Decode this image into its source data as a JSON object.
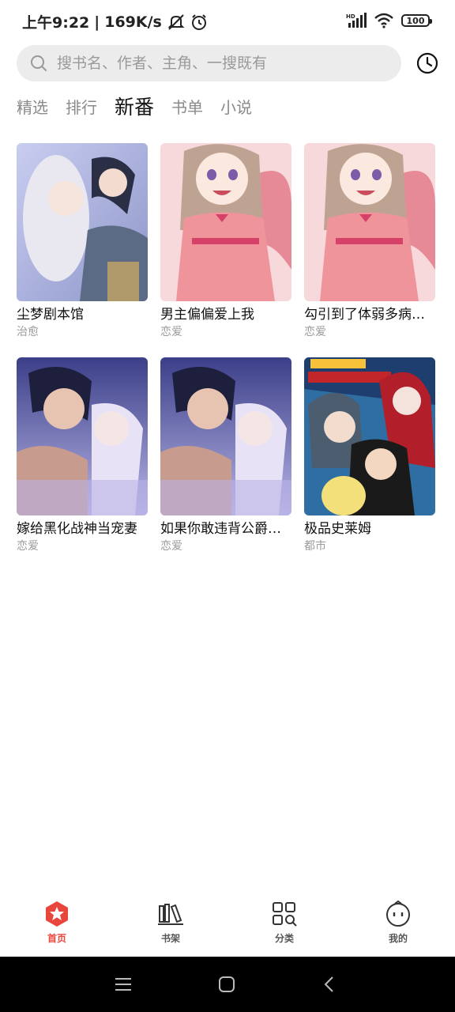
{
  "status_bar": {
    "time": "上午9:22",
    "net_speed": "169K/s",
    "battery": "100"
  },
  "search": {
    "placeholder": "搜书名、作者、主角、一搜既有"
  },
  "tabs": [
    {
      "label": "精选",
      "active": false
    },
    {
      "label": "排行",
      "active": false
    },
    {
      "label": "新番",
      "active": true
    },
    {
      "label": "书单",
      "active": false
    },
    {
      "label": "小说",
      "active": false
    }
  ],
  "books": [
    {
      "title": "尘梦剧本馆",
      "genre": "治愈"
    },
    {
      "title": "男主偏偏爱上我",
      "genre": "恋爱"
    },
    {
      "title": "勾引到了体弱多病…",
      "genre": "恋爱"
    },
    {
      "title": "嫁给黑化战神当宠妻",
      "genre": "恋爱"
    },
    {
      "title": "如果你敢违背公爵…",
      "genre": "恋爱"
    },
    {
      "title": "极品史莱姆",
      "genre": "都市"
    }
  ],
  "bottom_nav": [
    {
      "label": "首页",
      "icon": "home-star-icon",
      "active": true
    },
    {
      "label": "书架",
      "icon": "bookshelf-icon",
      "active": false
    },
    {
      "label": "分类",
      "icon": "category-grid-icon",
      "active": false
    },
    {
      "label": "我的",
      "icon": "profile-face-icon",
      "active": false
    }
  ],
  "colors": {
    "accent": "#e8453c",
    "search_bg": "#ececec",
    "tab_inactive": "#8a8a8a"
  }
}
